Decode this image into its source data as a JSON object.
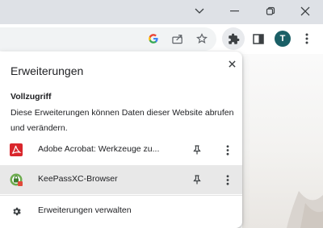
{
  "window": {
    "minimize_icon": "minimize-icon",
    "restore_icon": "restore-icon",
    "close_icon": "close-icon",
    "tab_dropdown_icon": "chevron-down-icon"
  },
  "toolbar": {
    "icons": [
      "google-g-icon",
      "share-icon",
      "star-icon",
      "puzzle-icon",
      "side-panel-icon"
    ],
    "profile_initial": "T",
    "menu_icon": "kebab-icon"
  },
  "popup": {
    "title": "Erweiterungen",
    "close_icon": "close-icon",
    "section_heading": "Vollzugriff",
    "section_description": "Diese Erweiterungen können Daten dieser Website abrufen und verändern.",
    "extensions": [
      {
        "name": "Adobe Acrobat: Werkzeuge zu...",
        "icon": "adobe-acrobat-icon",
        "pinned": false,
        "hovered": false
      },
      {
        "name": "KeePassXC-Browser",
        "icon": "keepassxc-icon",
        "pinned": false,
        "hovered": true
      }
    ],
    "manage_label": "Erweiterungen verwalten",
    "manage_icon": "gear-icon"
  },
  "colors": {
    "chrome_frame": "#dee1e6",
    "adobe_red": "#d9262c",
    "keepass_green": "#6cac4d",
    "profile_avatar": "#1a5f66",
    "google_blue": "#4285f4"
  }
}
